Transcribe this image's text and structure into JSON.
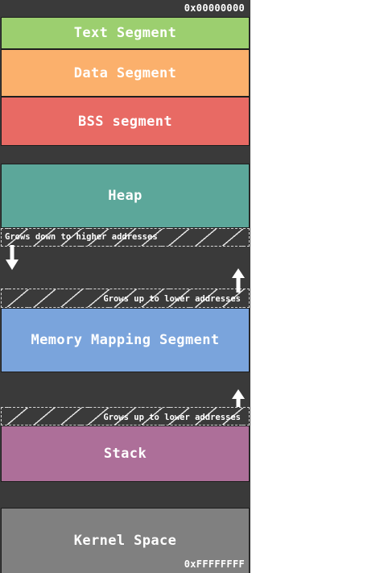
{
  "addresses": {
    "top": "0x00000000",
    "bottom": "0xFFFFFFFF"
  },
  "segments": {
    "text": {
      "label": "Text Segment",
      "color": "#9ccf6f"
    },
    "data": {
      "label": "Data Segment",
      "color": "#fbb06c"
    },
    "bss": {
      "label": "BSS segment",
      "color": "#e86a64"
    },
    "heap": {
      "label": "Heap",
      "color": "#5ca79a"
    },
    "mmap": {
      "label": "Memory Mapping Segment",
      "color": "#7aa4dc"
    },
    "stack": {
      "label": "Stack",
      "color": "#ad6f99"
    },
    "kernel": {
      "label": "Kernel Space",
      "color": "#808080"
    }
  },
  "growth": {
    "heap": "Grows down to higher addresses",
    "mmap": "Grows up to lower addresses",
    "stack": "Grows up to lower addresses"
  },
  "colors": {
    "gap": "#3a3a3a",
    "text": "#ffffff"
  },
  "icons": {
    "heap_arrow": "arrow-down-icon",
    "mmap_arrow": "arrow-up-icon",
    "stack_arrow": "arrow-up-icon"
  }
}
